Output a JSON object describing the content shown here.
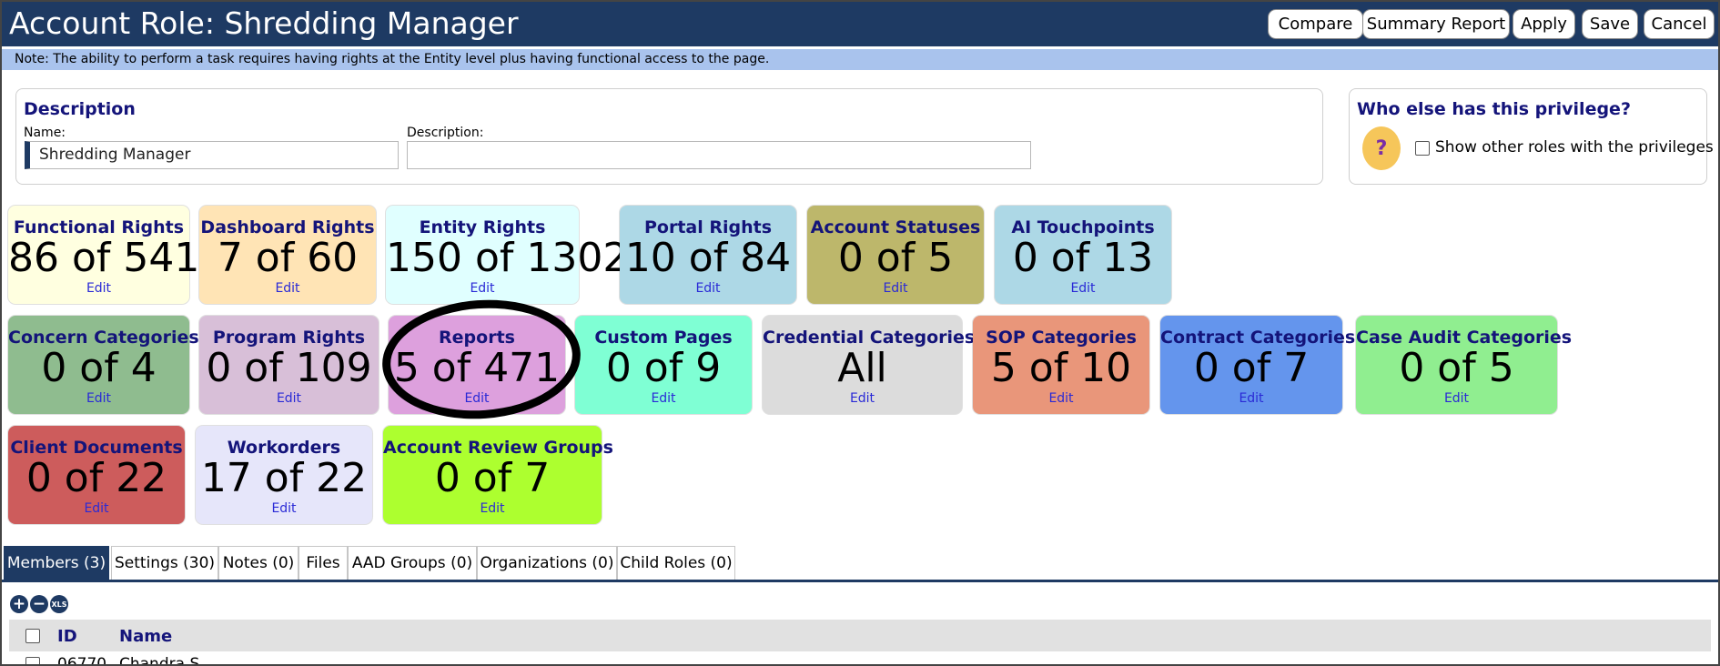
{
  "header": {
    "title": "Account Role: Shredding Manager",
    "buttons": [
      "Compare",
      "Summary Report",
      "Apply",
      "Save",
      "Cancel"
    ]
  },
  "note": "Note: The ability to perform a task requires having rights at the Entity level plus having functional access to the page.",
  "description_panel": {
    "heading": "Description",
    "name_label": "Name:",
    "name_value": "Shredding Manager",
    "description_label": "Description:",
    "description_value": ""
  },
  "privilege_panel": {
    "heading": "Who else has this privilege?",
    "icon": "question-person-icon",
    "checkbox_label": "Show other roles with the privileges",
    "checked": false
  },
  "tiles": [
    {
      "name": "Functional Rights",
      "value": "86 of 541",
      "edit": "Edit",
      "color": "#ffffe0"
    },
    {
      "name": "Dashboard Rights",
      "value": "7 of 60",
      "edit": "Edit",
      "color": "#ffe4b5"
    },
    {
      "name": "Entity Rights",
      "value": "150 of 1302",
      "edit": "Edit",
      "color": "#e0ffff"
    },
    {
      "name": "Portal Rights",
      "value": "10 of 84",
      "edit": "Edit",
      "color": "#add8e6"
    },
    {
      "name": "Account Statuses",
      "value": "0 of 5",
      "edit": "Edit",
      "color": "#bdb76b"
    },
    {
      "name": "AI Touchpoints",
      "value": "0 of 13",
      "edit": "Edit",
      "color": "#add8e6"
    },
    {
      "name": "Concern Categories",
      "value": "0 of 4",
      "edit": "Edit",
      "color": "#8fbc8f"
    },
    {
      "name": "Program Rights",
      "value": "0 of 109",
      "edit": "Edit",
      "color": "#d8bfd8"
    },
    {
      "name": "Reports",
      "value": "5 of 471",
      "edit": "Edit",
      "color": "#dda0dd"
    },
    {
      "name": "Custom Pages",
      "value": "0 of 9",
      "edit": "Edit",
      "color": "#7fffd4"
    },
    {
      "name": "Credential Categories",
      "value": "All",
      "edit": "Edit",
      "color": "#dcdcdc"
    },
    {
      "name": "SOP Categories",
      "value": "5 of 10",
      "edit": "Edit",
      "color": "#e9967a"
    },
    {
      "name": "Contract Categories",
      "value": "0 of 7",
      "edit": "Edit",
      "color": "#6495ed"
    },
    {
      "name": "Case Audit Categories",
      "value": "0 of 5",
      "edit": "Edit",
      "color": "#90ee90"
    },
    {
      "name": "Client Documents",
      "value": "0 of 22",
      "edit": "Edit",
      "color": "#cd5c5c"
    },
    {
      "name": "Workorders",
      "value": "17 of 22",
      "edit": "Edit",
      "color": "#e6e6fa"
    },
    {
      "name": "Account Review Groups",
      "value": "0 of 7",
      "edit": "Edit",
      "color": "#adff2f"
    }
  ],
  "tabs": [
    "Members (3)",
    "Settings (30)",
    "Notes (0)",
    "Files",
    "AAD Groups (0)",
    "Organizations (0)",
    "Child Roles (0)"
  ],
  "active_tab": "Members (3)",
  "toolbar": {
    "add": "+",
    "remove": "−",
    "export": "XLS"
  },
  "grid": {
    "columns": [
      "ID",
      "Name"
    ],
    "partial_row": {
      "id": "06770",
      "name": "Chandra S..."
    }
  },
  "colors": {
    "header": "#1e3a63",
    "note_bar": "#a9c3ed",
    "heading_text": "#14147a"
  }
}
